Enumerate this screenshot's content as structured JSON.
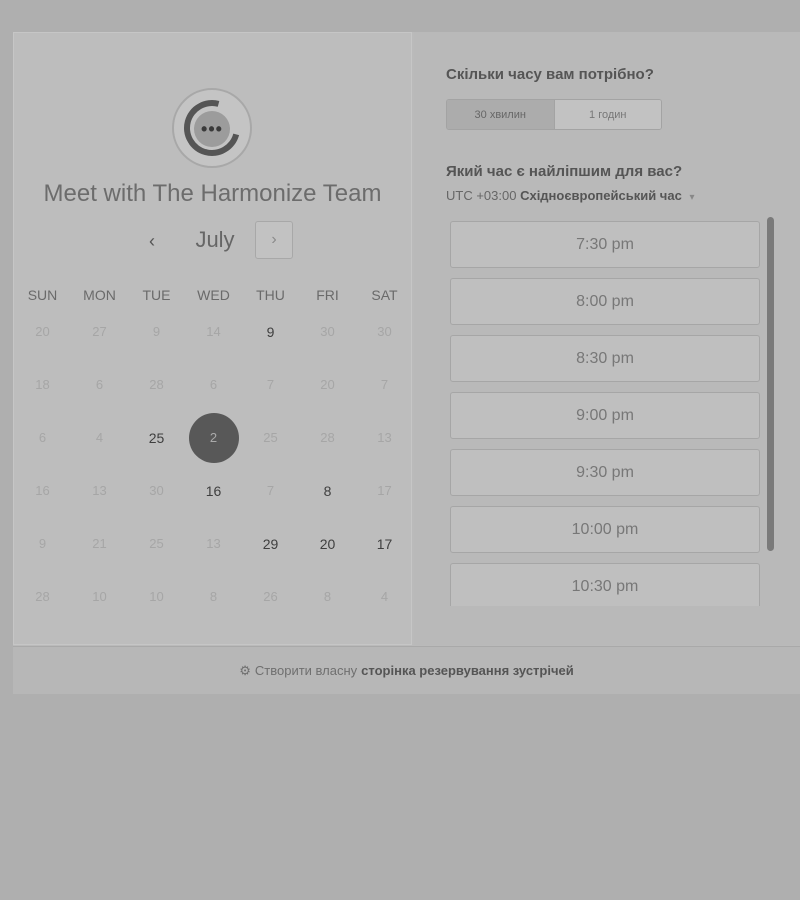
{
  "team_title": "Meet with The Harmonize Team",
  "calendar": {
    "month": "July",
    "prev_icon": "‹",
    "next_icon": "›",
    "weekdays": [
      "SUN",
      "MON",
      "TUE",
      "WED",
      "THU",
      "FRI",
      "SAT"
    ],
    "days": [
      {
        "n": "20",
        "state": "muted"
      },
      {
        "n": "27",
        "state": "muted"
      },
      {
        "n": "9",
        "state": "muted"
      },
      {
        "n": "14",
        "state": "muted"
      },
      {
        "n": "9",
        "state": "avail"
      },
      {
        "n": "30",
        "state": "muted"
      },
      {
        "n": "30",
        "state": "muted"
      },
      {
        "n": "18",
        "state": "muted"
      },
      {
        "n": "6",
        "state": "muted"
      },
      {
        "n": "28",
        "state": "muted"
      },
      {
        "n": "6",
        "state": "muted"
      },
      {
        "n": "7",
        "state": "muted"
      },
      {
        "n": "20",
        "state": "muted"
      },
      {
        "n": "7",
        "state": "muted"
      },
      {
        "n": "6",
        "state": "muted"
      },
      {
        "n": "4",
        "state": "muted"
      },
      {
        "n": "25",
        "state": "avail"
      },
      {
        "n": "2",
        "state": "selected"
      },
      {
        "n": "25",
        "state": "muted"
      },
      {
        "n": "28",
        "state": "muted"
      },
      {
        "n": "13",
        "state": "muted"
      },
      {
        "n": "16",
        "state": "muted"
      },
      {
        "n": "13",
        "state": "muted"
      },
      {
        "n": "30",
        "state": "muted"
      },
      {
        "n": "16",
        "state": "avail"
      },
      {
        "n": "7",
        "state": "muted"
      },
      {
        "n": "8",
        "state": "avail"
      },
      {
        "n": "17",
        "state": "muted"
      },
      {
        "n": "9",
        "state": "muted"
      },
      {
        "n": "21",
        "state": "muted"
      },
      {
        "n": "25",
        "state": "muted"
      },
      {
        "n": "13",
        "state": "muted"
      },
      {
        "n": "29",
        "state": "avail"
      },
      {
        "n": "20",
        "state": "avail"
      },
      {
        "n": "17",
        "state": "avail"
      },
      {
        "n": "28",
        "state": "muted"
      },
      {
        "n": "10",
        "state": "muted"
      },
      {
        "n": "10",
        "state": "muted"
      },
      {
        "n": "8",
        "state": "muted"
      },
      {
        "n": "26",
        "state": "muted"
      },
      {
        "n": "8",
        "state": "muted"
      },
      {
        "n": "4",
        "state": "muted"
      }
    ]
  },
  "duration": {
    "question": "Скільки часу вам потрібно?",
    "options": [
      "30 хвилин",
      "1 годин"
    ],
    "selected": "30 хвилин"
  },
  "time": {
    "question": "Який час є найліпшим для вас?",
    "tz_offset": "UTC +03:00",
    "tz_name": "Східноєвропейський час",
    "tz_caret": "▾",
    "slots": [
      "7:30 pm",
      "8:00 pm",
      "8:30 pm",
      "9:00 pm",
      "9:30 pm",
      "10:00 pm",
      "10:30 pm"
    ]
  },
  "footer": {
    "icon": "⚙",
    "prefix": "Створити власну",
    "link": "сторінка резервування зустрічей"
  },
  "colors": {
    "selected_day": "#585858",
    "background": "#afafaf"
  }
}
